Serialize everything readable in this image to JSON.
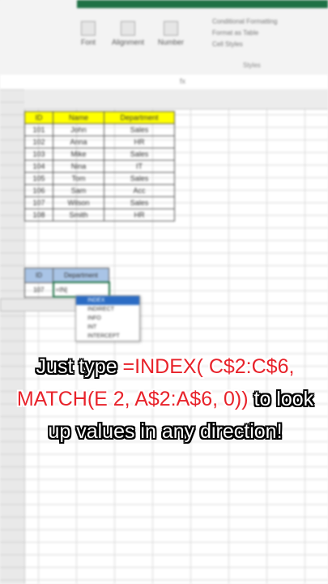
{
  "ribbon": {
    "buttons": [
      "Font",
      "Alignment",
      "Number"
    ],
    "menu_items": [
      "Conditional Formatting",
      "Format as Table",
      "Cell Styles"
    ],
    "group_label": "Styles"
  },
  "formula_bar": {
    "fx": "fx"
  },
  "table": {
    "headers": [
      "ID",
      "Name",
      "Department"
    ],
    "rows": [
      [
        "101",
        "John",
        "Sales"
      ],
      [
        "102",
        "Anna",
        "HR"
      ],
      [
        "103",
        "Mike",
        "Sales"
      ],
      [
        "104",
        "Nina",
        "IT"
      ],
      [
        "105",
        "Tom",
        "Sales"
      ],
      [
        "106",
        "Sam",
        "Acc"
      ],
      [
        "107",
        "Wilson",
        "Sales"
      ],
      [
        "108",
        "Smith",
        "HR"
      ]
    ]
  },
  "lookup": {
    "headers": [
      "ID",
      "Department"
    ],
    "id_value": "107",
    "formula_input": "=IN|"
  },
  "autocomplete": {
    "items": [
      "INDEX",
      "INDIRECT",
      "INFO",
      "INT",
      "INTERCEPT"
    ],
    "selected_index": 0
  },
  "caption": {
    "part1": "Just type ",
    "formula": "=INDEX( C$2:C$6, MATCH(E 2, A$2:A$6, 0))",
    "part2": " to look up values in any direction!"
  },
  "colors": {
    "header_fill": "#ffff00",
    "excel_green": "#1e7145",
    "caption_red": "#e8222a"
  }
}
